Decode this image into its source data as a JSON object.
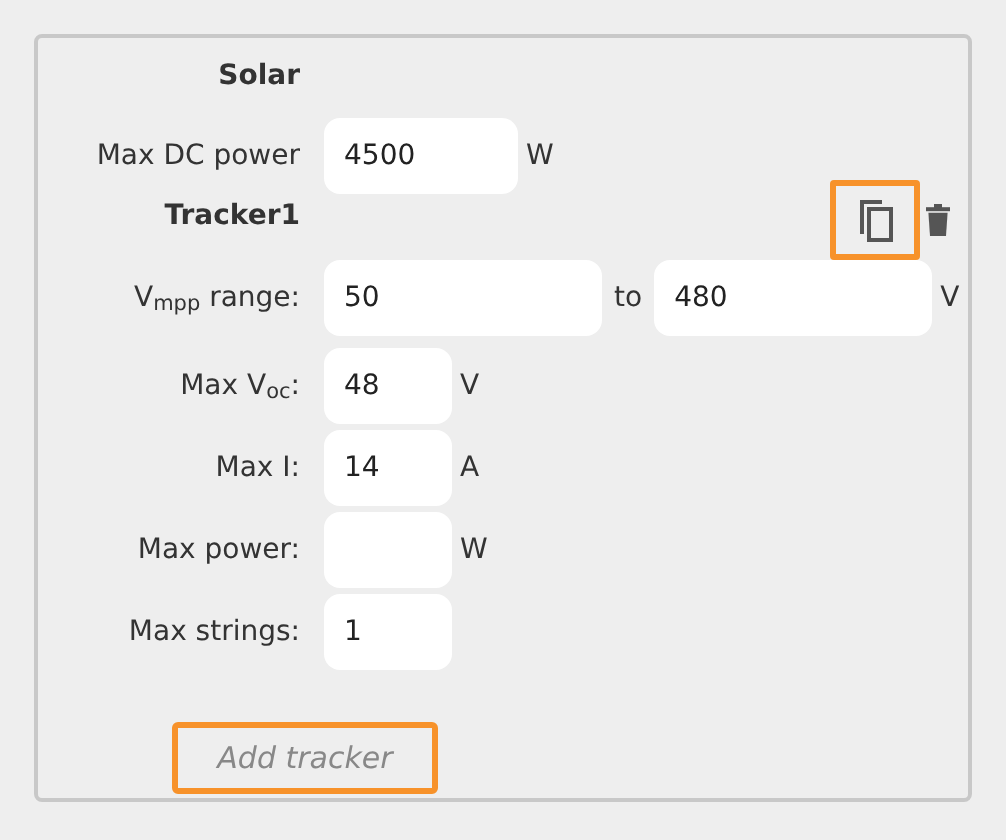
{
  "solar": {
    "title": "Solar",
    "fields": [
      {
        "label": "Max DC power",
        "kind": "wide",
        "value": "4500",
        "unit": "W"
      }
    ]
  },
  "tracker": {
    "title": "Tracker1",
    "actions": [
      {
        "kind": "copy",
        "highlighted": true
      },
      {
        "kind": "delete",
        "highlighted": false
      }
    ],
    "fields": [
      {
        "label": "V$_{mpp}$ range:",
        "kind": "range",
        "value": "50",
        "separator": "to",
        "value_2": "480",
        "unit": "V"
      },
      {
        "label": "Max V$_{oc}$:",
        "kind": "small",
        "value": "48",
        "unit": "V"
      },
      {
        "label": "Max I:",
        "kind": "small",
        "value": "14",
        "unit": "A"
      },
      {
        "label": "Max power:",
        "kind": "small",
        "unit": "W"
      },
      {
        "label": "Max strings:",
        "kind": "small",
        "value": "1"
      }
    ]
  },
  "add_button": {
    "label": "Add tracker",
    "highlighted": true
  }
}
